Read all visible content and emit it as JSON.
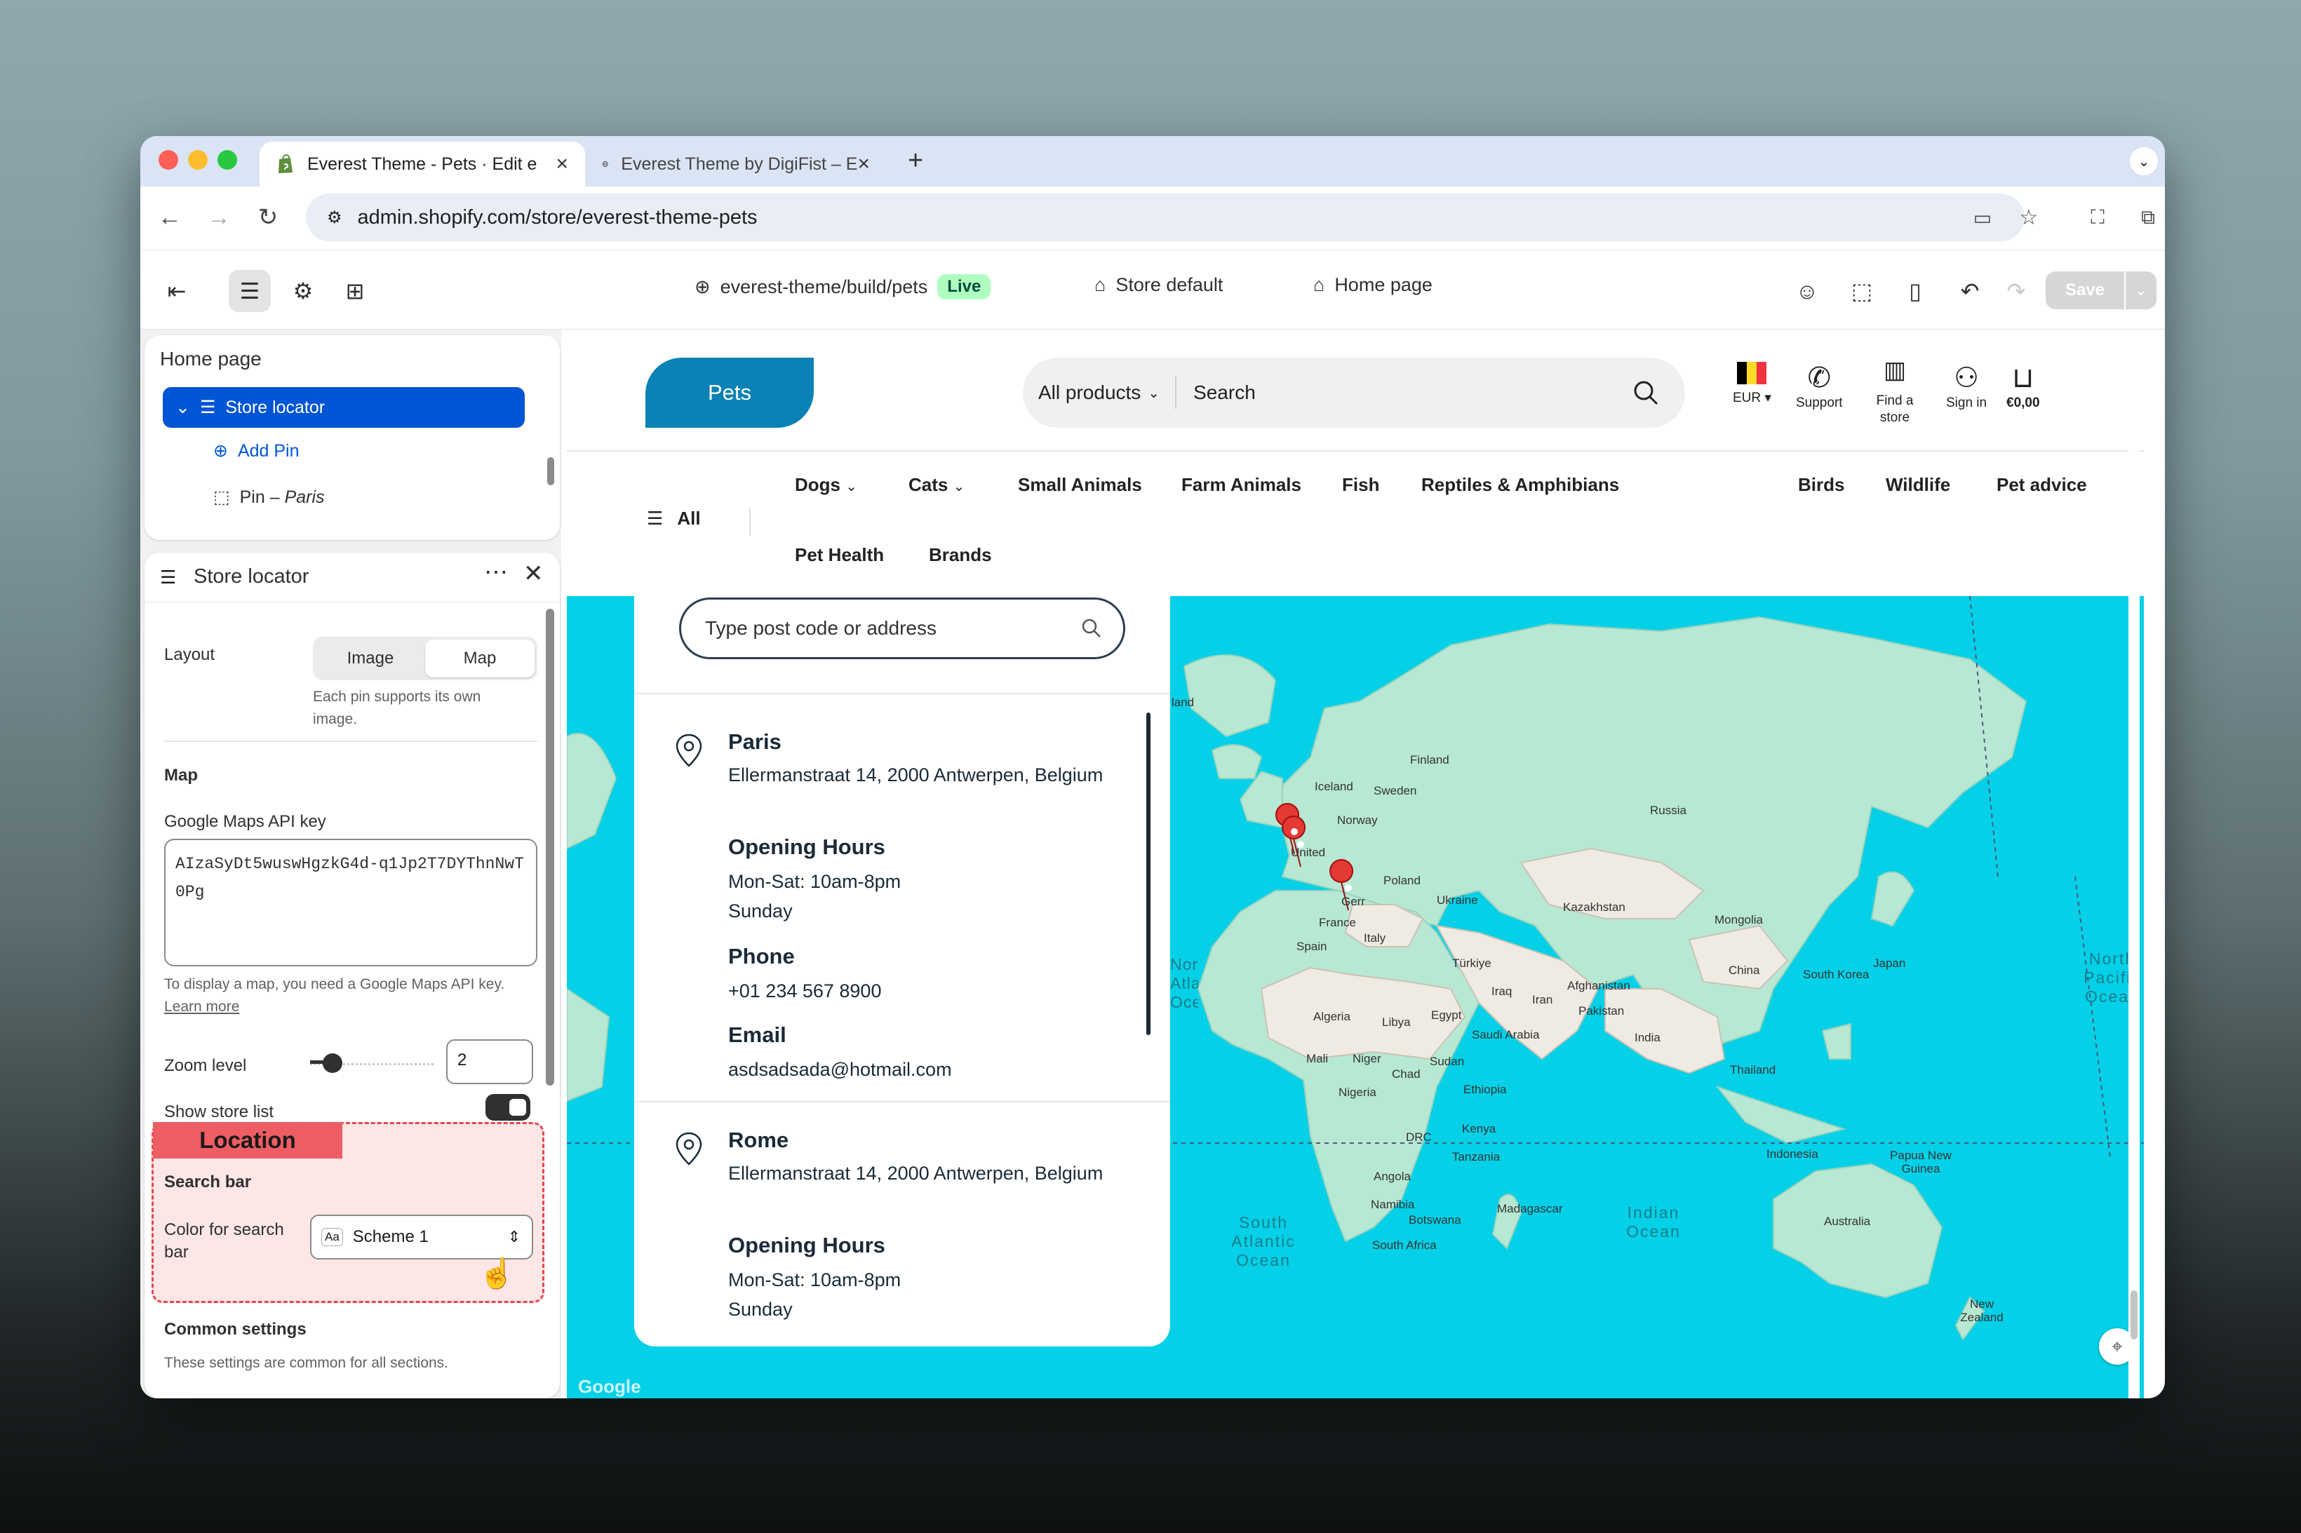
{
  "browser": {
    "tabs": [
      {
        "title": "Everest Theme - Pets · Edit e",
        "active": true
      },
      {
        "title": "Everest Theme by DigiFist – E",
        "active": false
      }
    ],
    "url": "admin.shopify.com/store/everest-theme-pets"
  },
  "editor": {
    "theme_path": "everest-theme/build/pets",
    "live_badge": "Live",
    "store_label": "Store default",
    "page_label": "Home page",
    "save_label": "Save"
  },
  "sidebar": {
    "page_title": "Home page",
    "tree": {
      "section": "Store locator",
      "add_pin": "Add Pin",
      "pin_prefix": "Pin – ",
      "pin_name": "Paris"
    },
    "settings_title": "Store locator",
    "layout": {
      "label": "Layout",
      "options": [
        "Image",
        "Map"
      ],
      "selected": "Map",
      "help": "Each pin supports its own image."
    },
    "map_heading": "Map",
    "api_key": {
      "label": "Google Maps API key",
      "value": "AIzaSyDt5wuswHgzkG4d-q1Jp2T7DYThnNwT0Pg",
      "help": "To display a map, you need a Google Maps API key.",
      "learn_more": "Learn more"
    },
    "zoom": {
      "label": "Zoom level",
      "value": "2"
    },
    "show_store_list": {
      "label": "Show store list",
      "on": true
    },
    "annotation": "Location",
    "search_bar_heading": "Search bar",
    "color_search": {
      "label": "Color for search bar",
      "value": "Scheme 1",
      "swatch": "Aa"
    },
    "common_heading": "Common settings",
    "common_help": "These settings are common for all sections."
  },
  "store": {
    "logo": "Pets",
    "search": {
      "category": "All products",
      "placeholder": "Search"
    },
    "header_icons": [
      {
        "label": "EUR ▾"
      },
      {
        "label": "Support"
      },
      {
        "label": "Find a store"
      },
      {
        "label": "Sign in"
      },
      {
        "label": "€0,00"
      }
    ],
    "nav": {
      "all": "All",
      "items": [
        "Dogs",
        "Cats",
        "Small Animals",
        "Farm Animals",
        "Fish",
        "Reptiles & Amphibians",
        "Birds",
        "Wildlife",
        "Pet advice",
        "Pet Health",
        "Brands"
      ]
    },
    "locator": {
      "placeholder": "Type post code or address",
      "locations": [
        {
          "name": "Paris",
          "address": "Ellermanstraat 14, 2000 Antwerpen, Belgium",
          "hours_title": "Opening Hours",
          "hours": [
            "Mon-Sat: 10am-8pm",
            "Sunday"
          ],
          "phone_title": "Phone",
          "phone": "+01 234 567 8900",
          "email_title": "Email",
          "email": "asdsadsada@hotmail.com"
        },
        {
          "name": "Rome",
          "address": "Ellermanstraat 14, 2000 Antwerpen, Belgium",
          "hours_title": "Opening Hours",
          "hours": [
            "Mon-Sat: 10am-8pm",
            "Sunday"
          ]
        }
      ]
    },
    "map_labels": {
      "countries": [
        "Finland",
        "Iceland",
        "Sweden",
        "Norway",
        "Russia",
        "United Kingdom",
        "Poland",
        "Ukraine",
        "Germany",
        "France",
        "Italy",
        "Spain",
        "Kazakhstan",
        "Mongolia",
        "Türkiye",
        "Iraq",
        "Iran",
        "Afghanistan",
        "Pakistan",
        "China",
        "South Korea",
        "Japan",
        "Algeria",
        "Libya",
        "Egypt",
        "Saudi Arabia",
        "India",
        "Mali",
        "Niger",
        "Chad",
        "Sudan",
        "Ethiopia",
        "Nigeria",
        "Thailand",
        "DRC",
        "Kenya",
        "Tanzania",
        "Indonesia",
        "Papua New Guinea",
        "Angola",
        "Namibia",
        "Botswana",
        "Madagascar",
        "South Africa",
        "Australia",
        "New Zealand"
      ],
      "oceans": [
        "North Pacific Ocean",
        "Indian Ocean",
        "South Atlantic Ocean",
        "North Atlantic Ocean"
      ],
      "partial": [
        "land"
      ],
      "attribution": "Google"
    }
  },
  "colors": {
    "accent": "#0055d4",
    "logo": "#0a82b5",
    "map_water": "#04d0e7",
    "land": "#a9e4cd",
    "annotation": "#ef5d64",
    "live_bg": "#affebf",
    "pin": "#e53935"
  }
}
